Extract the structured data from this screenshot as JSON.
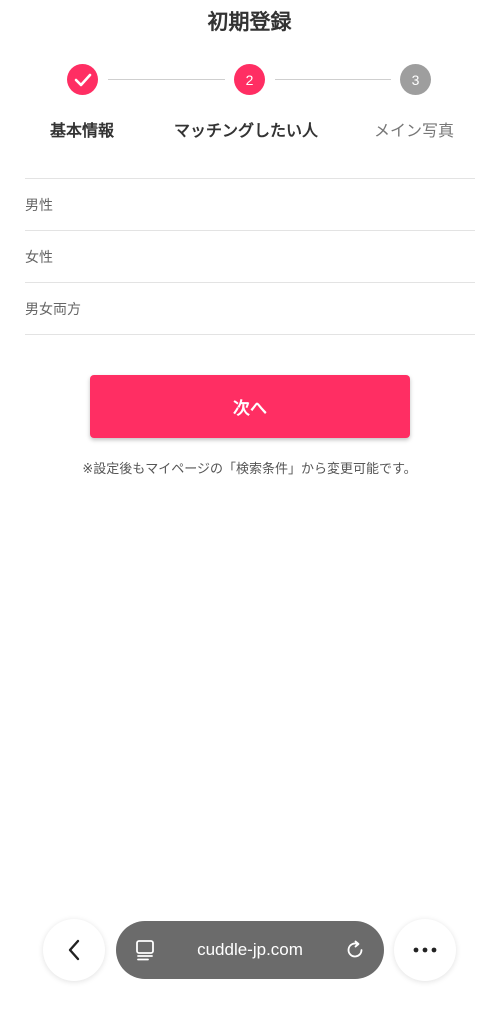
{
  "header": {
    "title": "初期登録"
  },
  "stepper": {
    "steps": [
      {
        "number": "",
        "label": "基本情報",
        "state": "done"
      },
      {
        "number": "2",
        "label": "マッチングしたい人",
        "state": "current"
      },
      {
        "number": "3",
        "label": "メイン写真",
        "state": "upcoming"
      }
    ]
  },
  "options": [
    {
      "label": "男性"
    },
    {
      "label": "女性"
    },
    {
      "label": "男女両方"
    }
  ],
  "next_button": {
    "label": "次へ"
  },
  "note": "※設定後もマイページの「検索条件」から変更可能です。",
  "browser_bar": {
    "url": "cuddle-jp.com",
    "icons": [
      "chevron-left-icon",
      "tabs-icon",
      "reload-icon",
      "more-icon"
    ]
  },
  "colors": {
    "accent": "#ff2e63",
    "inactive_step": "#9e9e9e",
    "url_pill": "#6b6b6b"
  }
}
